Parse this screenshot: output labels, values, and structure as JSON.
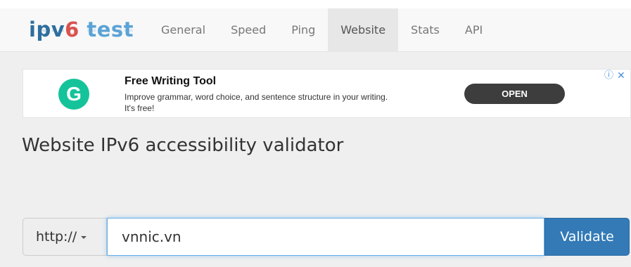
{
  "brand": {
    "logo_part1": "ipv",
    "logo_part2": "6",
    "logo_part3": " test",
    "colors": {
      "primary": "#2e6e9e",
      "accent_red": "#d9534f",
      "accent_light": "#5ba3d6"
    }
  },
  "nav": {
    "items": [
      "General",
      "Speed",
      "Ping",
      "Website",
      "Stats",
      "API"
    ],
    "active": "Website"
  },
  "ad": {
    "logo_letter": "G",
    "title": "Free Writing Tool",
    "description": "Improve grammar, word choice, and sentence structure in your writing. It's free!",
    "cta": "OPEN",
    "info_icon": "ⓘ",
    "close_icon": "✕",
    "colors": {
      "logo": "#15c39a",
      "cta": "#3d3d3d"
    }
  },
  "main": {
    "heading": "Website IPv6 accessibility validator",
    "form": {
      "scheme": "http://",
      "url_value": "vnnic.vn",
      "submit_label": "Validate",
      "colors": {
        "submit": "#337ab7"
      }
    }
  }
}
